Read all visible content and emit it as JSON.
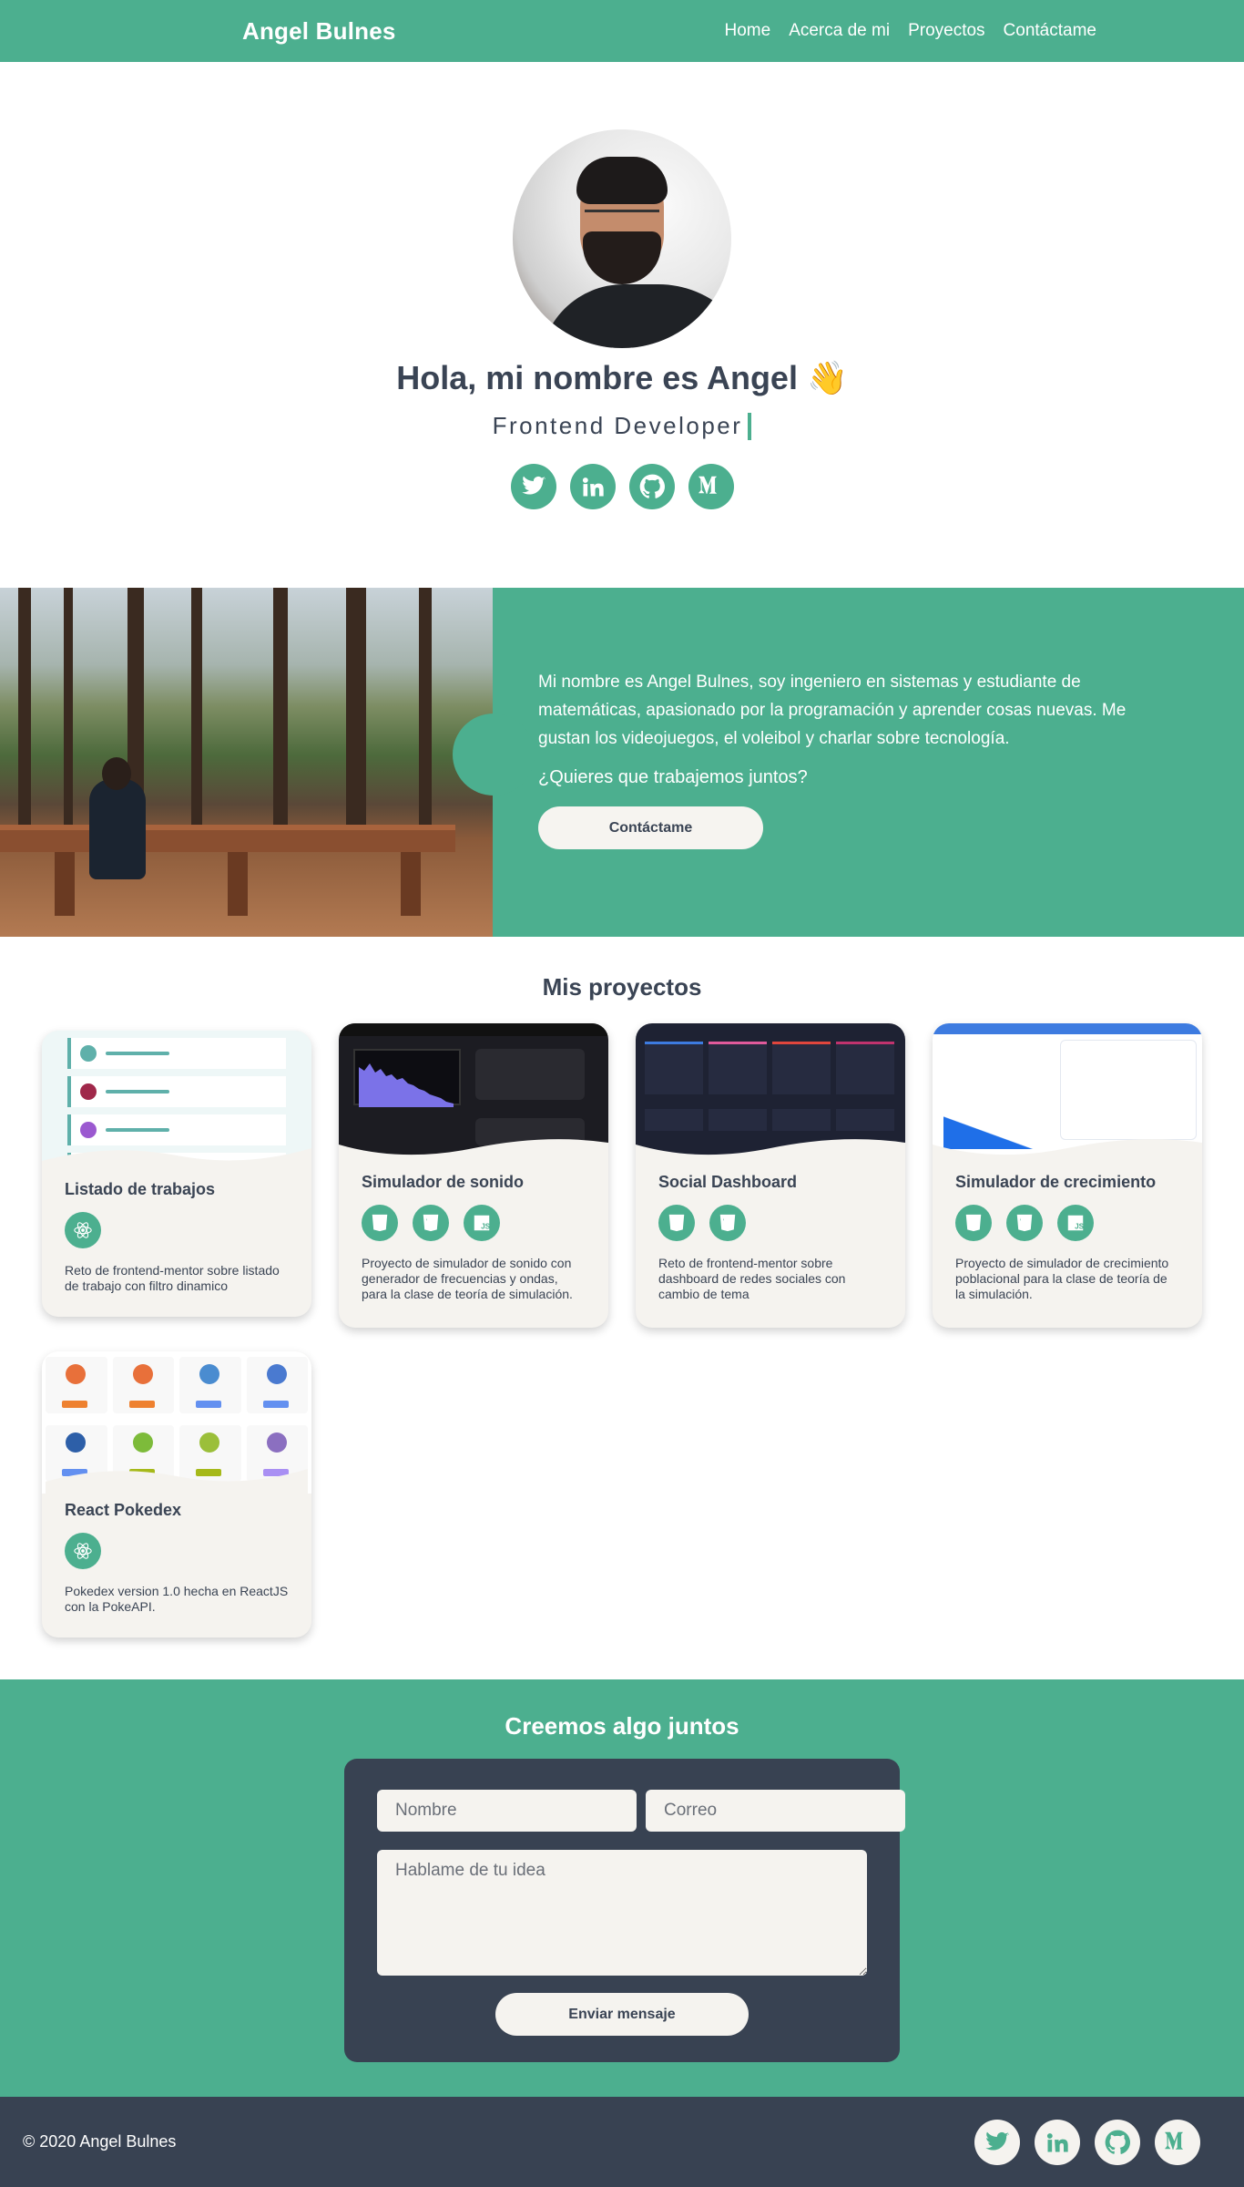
{
  "nav": {
    "brand": "Angel Bulnes",
    "links": [
      "Home",
      "Acerca de mi",
      "Proyectos",
      "Contáctame"
    ]
  },
  "hero": {
    "title": "Hola, mi nombre es Angel 👋",
    "subtitle": "Frontend Developer",
    "socials": [
      "twitter-icon",
      "linkedin-icon",
      "github-icon",
      "medium-icon"
    ]
  },
  "about": {
    "paragraph": "Mi nombre es Angel Bulnes, soy ingeniero en sistemas y estudiante de matemáticas, apasionado por la programación y aprender cosas nuevas. Me gustan los videojuegos, el voleibol y charlar sobre tecnología.",
    "question": "¿Quieres que trabajemos juntos?",
    "button": "Contáctame"
  },
  "projects": {
    "title": "Mis proyectos",
    "items": [
      {
        "title": "Listado de trabajos",
        "tech": [
          "react-icon"
        ],
        "desc": "Reto de frontend-mentor sobre listado de trabajo con filtro dinamico"
      },
      {
        "title": "Simulador de sonido",
        "tech": [
          "html5-icon",
          "css3-icon",
          "js-icon"
        ],
        "desc": "Proyecto de simulador de sonido con generador de frecuencias y ondas, para la clase de teoría de simulación."
      },
      {
        "title": "Social Dashboard",
        "tech": [
          "html5-icon",
          "css3-icon"
        ],
        "desc": "Reto de frontend-mentor sobre dashboard de redes sociales con cambio de tema"
      },
      {
        "title": "Simulador de crecimiento",
        "tech": [
          "html5-icon",
          "css3-icon",
          "js-icon"
        ],
        "desc": "Proyecto de simulador de crecimiento poblacional para la clase de teoría de la simulación."
      },
      {
        "title": "React Pokedex",
        "tech": [
          "react-icon"
        ],
        "desc": "Pokedex version 1.0 hecha en ReactJS con la PokeAPI."
      }
    ]
  },
  "contact": {
    "title": "Creemos algo juntos",
    "name_placeholder": "Nombre",
    "email_placeholder": "Correo",
    "message_placeholder": "Hablame de tu idea",
    "button": "Enviar mensaje"
  },
  "footer": {
    "copyright": "© 2020 Angel Bulnes"
  },
  "colors": {
    "accent": "#4caf8f",
    "dark": "#384252",
    "light": "#f5f3ef"
  }
}
